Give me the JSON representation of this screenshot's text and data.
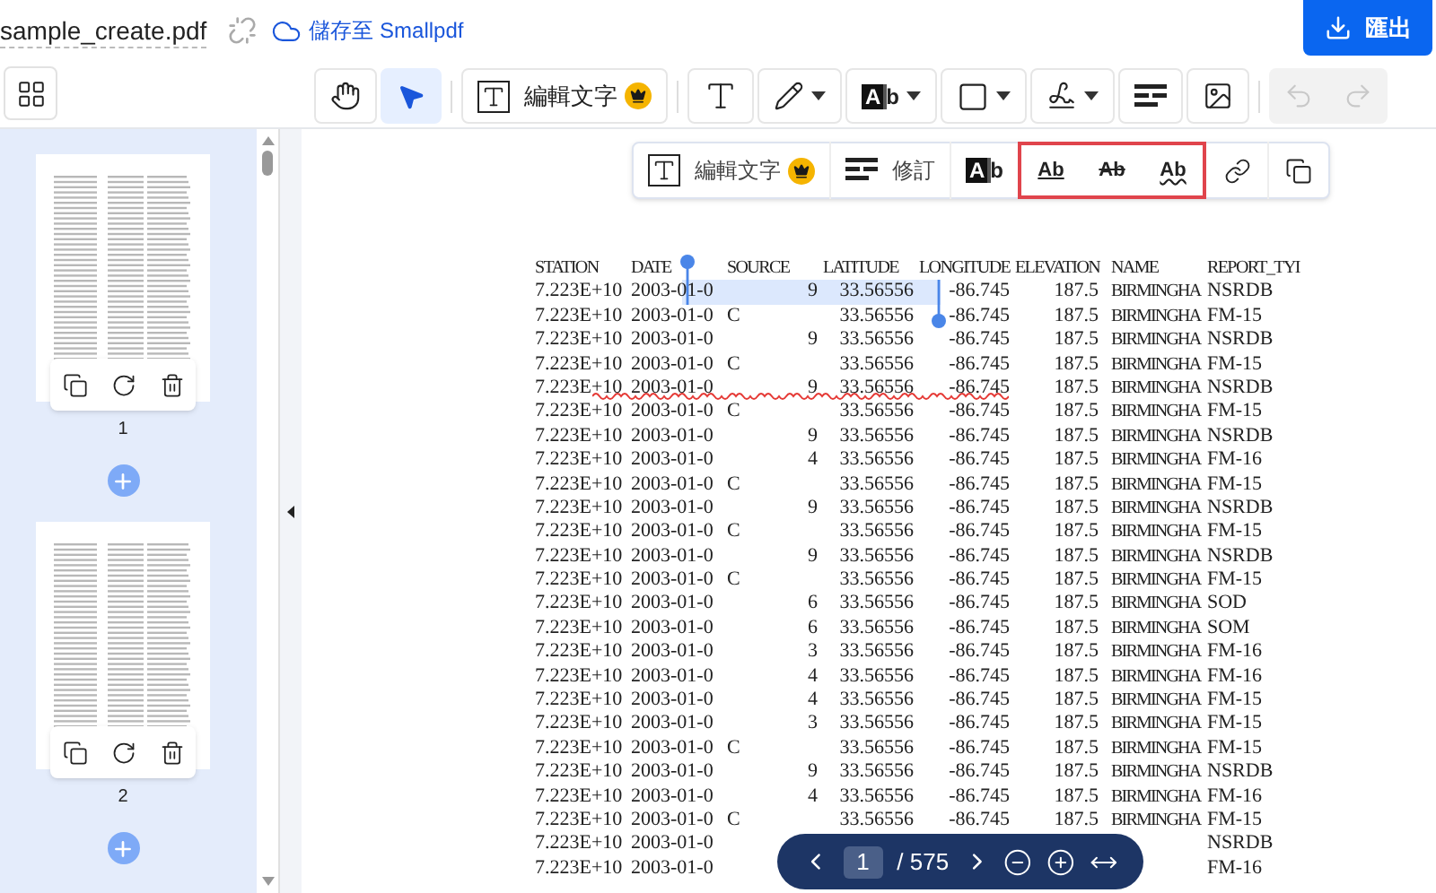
{
  "header": {
    "file_name": "sample_create.pdf",
    "save_link": "儲存至 Smallpdf",
    "export_button": "匯出"
  },
  "toolbar": {
    "tools": [
      {
        "kind": "hand",
        "selected": false
      },
      {
        "kind": "select",
        "selected": true
      },
      {
        "kind": "edit_text",
        "label": "編輯文字",
        "selected": false
      },
      {
        "kind": "text",
        "selected": false
      },
      {
        "kind": "pencil",
        "menu": true,
        "selected": false
      },
      {
        "kind": "text_box",
        "label": "Ab",
        "menu": true,
        "selected": false
      },
      {
        "kind": "shape",
        "menu": true,
        "selected": false
      },
      {
        "kind": "signature",
        "menu": true,
        "selected": false
      },
      {
        "kind": "redact",
        "selected": false
      },
      {
        "kind": "image",
        "selected": false
      }
    ],
    "undo_disabled": true,
    "redo_disabled": true
  },
  "thumbnails": [
    {
      "page": "1"
    },
    {
      "page": "2"
    }
  ],
  "text_toolbar": [
    {
      "kind": "edit_text",
      "label": "編輯文字",
      "highlighted": false
    },
    {
      "kind": "revise",
      "label": "修訂",
      "highlighted": false
    },
    {
      "kind": "text_box",
      "label": "Ab",
      "highlighted": false
    },
    {
      "kind": "underline",
      "label": "Ab",
      "highlighted": true
    },
    {
      "kind": "strikethrough",
      "label": "Ab",
      "highlighted": true
    },
    {
      "kind": "squiggly",
      "label": "Ab",
      "highlighted": true
    },
    {
      "kind": "link",
      "highlighted": false
    },
    {
      "kind": "copy",
      "highlighted": false
    }
  ],
  "document": {
    "columns": [
      "STATION",
      "DATE",
      "SOURCE",
      "LATITUDE",
      "LONGITUDE",
      "ELEVATION",
      "NAME",
      "REPORT_TYI"
    ],
    "rows": [
      {
        "station": "7.223E+10",
        "date": "2003-01-0",
        "source_num": "9",
        "latitude": "33.56556",
        "longitude": "-86.745",
        "elevation": "187.5",
        "name": "BIRMINGHA",
        "report_type": "NSRDB",
        "selected": true,
        "squiggle": false
      },
      {
        "station": "7.223E+10",
        "date": "2003-01-0",
        "source_code": "C",
        "latitude": "33.56556",
        "longitude": "-86.745",
        "elevation": "187.5",
        "name": "BIRMINGHA",
        "report_type": "FM-15",
        "selected": false,
        "squiggle": false
      },
      {
        "station": "7.223E+10",
        "date": "2003-01-0",
        "source_num": "9",
        "latitude": "33.56556",
        "longitude": "-86.745",
        "elevation": "187.5",
        "name": "BIRMINGHA",
        "report_type": "NSRDB",
        "selected": false,
        "squiggle": false
      },
      {
        "station": "7.223E+10",
        "date": "2003-01-0",
        "source_code": "C",
        "latitude": "33.56556",
        "longitude": "-86.745",
        "elevation": "187.5",
        "name": "BIRMINGHA",
        "report_type": "FM-15",
        "selected": false,
        "squiggle": false
      },
      {
        "station": "7.223E+10",
        "date": "2003-01-0",
        "source_num": "9",
        "latitude": "33.56556",
        "longitude": "-86.745",
        "elevation": "187.5",
        "name": "BIRMINGHA",
        "report_type": "NSRDB",
        "selected": false,
        "squiggle": true
      },
      {
        "station": "7.223E+10",
        "date": "2003-01-0",
        "source_code": "C",
        "latitude": "33.56556",
        "longitude": "-86.745",
        "elevation": "187.5",
        "name": "BIRMINGHA",
        "report_type": "FM-15",
        "selected": false,
        "squiggle": false
      },
      {
        "station": "7.223E+10",
        "date": "2003-01-0",
        "source_num": "9",
        "latitude": "33.56556",
        "longitude": "-86.745",
        "elevation": "187.5",
        "name": "BIRMINGHA",
        "report_type": "NSRDB",
        "selected": false,
        "squiggle": false
      },
      {
        "station": "7.223E+10",
        "date": "2003-01-0",
        "source_num": "4",
        "latitude": "33.56556",
        "longitude": "-86.745",
        "elevation": "187.5",
        "name": "BIRMINGHA",
        "report_type": "FM-16",
        "selected": false,
        "squiggle": false
      },
      {
        "station": "7.223E+10",
        "date": "2003-01-0",
        "source_code": "C",
        "latitude": "33.56556",
        "longitude": "-86.745",
        "elevation": "187.5",
        "name": "BIRMINGHA",
        "report_type": "FM-15",
        "selected": false,
        "squiggle": false
      },
      {
        "station": "7.223E+10",
        "date": "2003-01-0",
        "source_num": "9",
        "latitude": "33.56556",
        "longitude": "-86.745",
        "elevation": "187.5",
        "name": "BIRMINGHA",
        "report_type": "NSRDB",
        "selected": false,
        "squiggle": false
      },
      {
        "station": "7.223E+10",
        "date": "2003-01-0",
        "source_code": "C",
        "latitude": "33.56556",
        "longitude": "-86.745",
        "elevation": "187.5",
        "name": "BIRMINGHA",
        "report_type": "FM-15",
        "selected": false,
        "squiggle": false
      },
      {
        "station": "7.223E+10",
        "date": "2003-01-0",
        "source_num": "9",
        "latitude": "33.56556",
        "longitude": "-86.745",
        "elevation": "187.5",
        "name": "BIRMINGHA",
        "report_type": "NSRDB",
        "selected": false,
        "squiggle": false
      },
      {
        "station": "7.223E+10",
        "date": "2003-01-0",
        "source_code": "C",
        "latitude": "33.56556",
        "longitude": "-86.745",
        "elevation": "187.5",
        "name": "BIRMINGHA",
        "report_type": "FM-15",
        "selected": false,
        "squiggle": false
      },
      {
        "station": "7.223E+10",
        "date": "2003-01-0",
        "source_num": "6",
        "latitude": "33.56556",
        "longitude": "-86.745",
        "elevation": "187.5",
        "name": "BIRMINGHA",
        "report_type": "SOD",
        "selected": false,
        "squiggle": false
      },
      {
        "station": "7.223E+10",
        "date": "2003-01-0",
        "source_num": "6",
        "latitude": "33.56556",
        "longitude": "-86.745",
        "elevation": "187.5",
        "name": "BIRMINGHA",
        "report_type": "SOM",
        "selected": false,
        "squiggle": false
      },
      {
        "station": "7.223E+10",
        "date": "2003-01-0",
        "source_num": "3",
        "latitude": "33.56556",
        "longitude": "-86.745",
        "elevation": "187.5",
        "name": "BIRMINGHA",
        "report_type": "FM-16",
        "selected": false,
        "squiggle": false
      },
      {
        "station": "7.223E+10",
        "date": "2003-01-0",
        "source_num": "4",
        "latitude": "33.56556",
        "longitude": "-86.745",
        "elevation": "187.5",
        "name": "BIRMINGHA",
        "report_type": "FM-16",
        "selected": false,
        "squiggle": false
      },
      {
        "station": "7.223E+10",
        "date": "2003-01-0",
        "source_num": "4",
        "latitude": "33.56556",
        "longitude": "-86.745",
        "elevation": "187.5",
        "name": "BIRMINGHA",
        "report_type": "FM-15",
        "selected": false,
        "squiggle": false
      },
      {
        "station": "7.223E+10",
        "date": "2003-01-0",
        "source_num": "3",
        "latitude": "33.56556",
        "longitude": "-86.745",
        "elevation": "187.5",
        "name": "BIRMINGHA",
        "report_type": "FM-15",
        "selected": false,
        "squiggle": false
      },
      {
        "station": "7.223E+10",
        "date": "2003-01-0",
        "source_code": "C",
        "latitude": "33.56556",
        "longitude": "-86.745",
        "elevation": "187.5",
        "name": "BIRMINGHA",
        "report_type": "FM-15",
        "selected": false,
        "squiggle": false
      },
      {
        "station": "7.223E+10",
        "date": "2003-01-0",
        "source_num": "9",
        "latitude": "33.56556",
        "longitude": "-86.745",
        "elevation": "187.5",
        "name": "BIRMINGHA",
        "report_type": "NSRDB",
        "selected": false,
        "squiggle": false
      },
      {
        "station": "7.223E+10",
        "date": "2003-01-0",
        "source_num": "4",
        "latitude": "33.56556",
        "longitude": "-86.745",
        "elevation": "187.5",
        "name": "BIRMINGHA",
        "report_type": "FM-16",
        "selected": false,
        "squiggle": false
      },
      {
        "station": "7.223E+10",
        "date": "2003-01-0",
        "source_code": "C",
        "latitude": "33.56556",
        "longitude": "-86.745",
        "elevation": "187.5",
        "name": "BIRMINGHA",
        "report_type": "FM-15",
        "selected": false,
        "squiggle": false
      },
      {
        "station": "7.223E+10",
        "date": "2003-01-0",
        "report_type": "NSRDB",
        "selected": false,
        "squiggle": false
      },
      {
        "station": "7.223E+10",
        "date": "2003-01-0",
        "report_type": "FM-16",
        "selected": false,
        "squiggle": false
      }
    ]
  },
  "pagination": {
    "page": "1",
    "total": "/ 575"
  }
}
